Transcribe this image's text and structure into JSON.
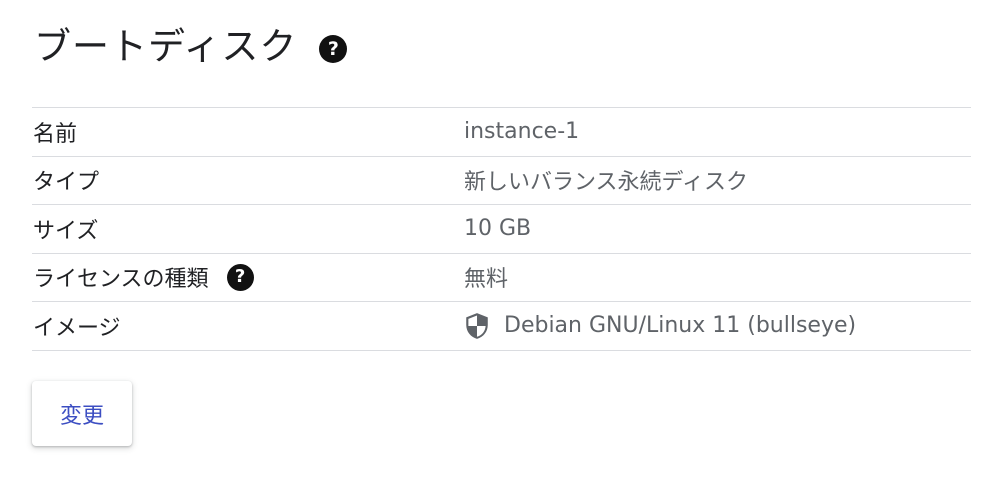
{
  "section": {
    "title": "ブートディスク",
    "help_icon": "help-circle-icon"
  },
  "rows": [
    {
      "label": "名前",
      "value": "instance-1"
    },
    {
      "label": "タイプ",
      "value": "新しいバランス永続ディスク"
    },
    {
      "label": "サイズ",
      "value": "10 GB"
    },
    {
      "label": "ライセンスの種類",
      "value": "無料",
      "label_icon": "help-circle-icon"
    },
    {
      "label": "イメージ",
      "value": "Debian GNU/Linux 11 (bullseye)",
      "value_icon": "shield-icon"
    }
  ],
  "actions": {
    "change_label": "変更"
  },
  "colors": {
    "text": "#202124",
    "secondary_text": "#5f6368",
    "divider": "#dadce0",
    "button_text": "#3c4ec2"
  }
}
